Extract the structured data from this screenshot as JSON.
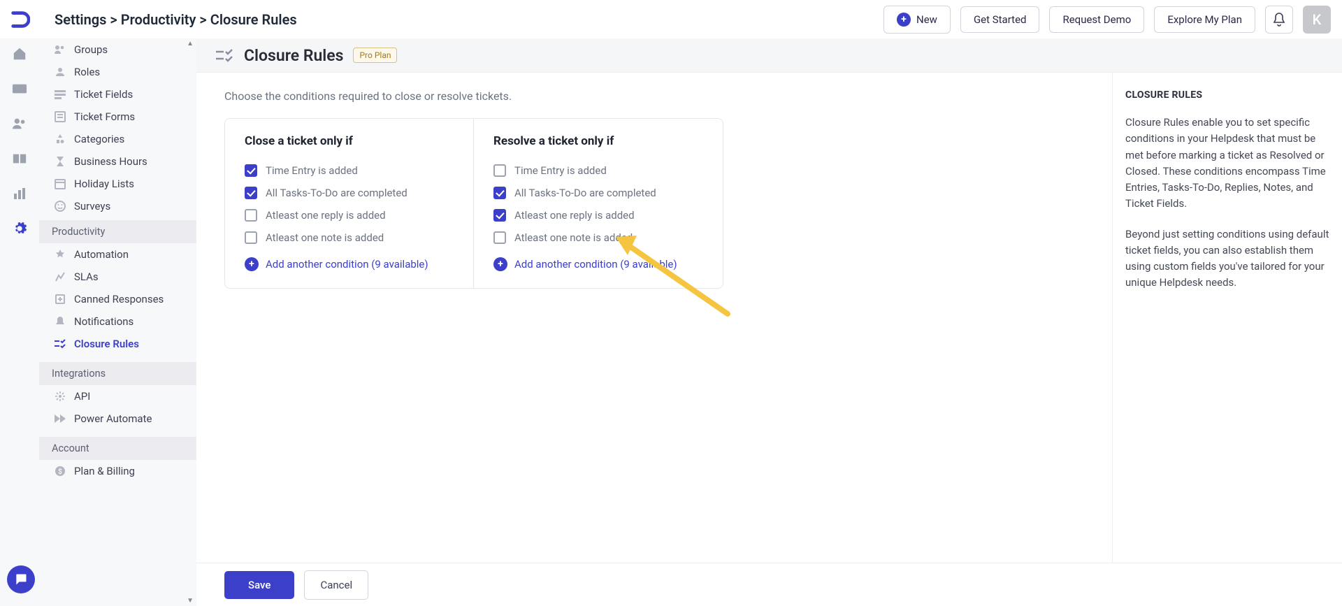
{
  "breadcrumb": "Settings > Productivity > Closure Rules",
  "topbar": {
    "newLabel": "New",
    "buttons": [
      "Get Started",
      "Request Demo",
      "Explore My Plan"
    ],
    "avatarInitial": "K"
  },
  "sidebar": {
    "section1": [
      "Groups",
      "Roles",
      "Ticket Fields",
      "Ticket Forms",
      "Categories",
      "Business Hours",
      "Holiday Lists",
      "Surveys"
    ],
    "productivityHeader": "Productivity",
    "productivity": [
      "Automation",
      "SLAs",
      "Canned Responses",
      "Notifications",
      "Closure Rules"
    ],
    "productivityActiveIndex": 4,
    "integrationsHeader": "Integrations",
    "integrations": [
      "API",
      "Power Automate"
    ],
    "accountHeader": "Account",
    "account": [
      "Plan & Billing"
    ]
  },
  "page": {
    "title": "Closure Rules",
    "badge": "Pro Plan",
    "intro": "Choose the conditions required to close or resolve tickets."
  },
  "closeCard": {
    "title": "Close a ticket only if",
    "conditions": [
      {
        "label": "Time Entry is added",
        "checked": true
      },
      {
        "label": "All Tasks-To-Do are completed",
        "checked": true
      },
      {
        "label": "Atleast one reply is added",
        "checked": false
      },
      {
        "label": "Atleast one note is added",
        "checked": false
      }
    ],
    "addLabel": "Add another condition (9 available)"
  },
  "resolveCard": {
    "title": "Resolve a ticket only if",
    "conditions": [
      {
        "label": "Time Entry is added",
        "checked": false
      },
      {
        "label": "All Tasks-To-Do are completed",
        "checked": true
      },
      {
        "label": "Atleast one reply is added",
        "checked": true
      },
      {
        "label": "Atleast one note is added",
        "checked": false
      }
    ],
    "addLabel": "Add another condition (9 available)"
  },
  "info": {
    "title": "CLOSURE RULES",
    "para1": "Closure Rules enable you to set specific conditions in your Helpdesk that must be met before marking a ticket as Resolved or Closed. These conditions encompass Time Entries, Tasks-To-Do, Replies, Notes, and Ticket Fields.",
    "para2": "Beyond just setting conditions using default ticket fields, you can also establish them using custom fields you've tailored for your unique Helpdesk needs."
  },
  "footer": {
    "save": "Save",
    "cancel": "Cancel"
  }
}
